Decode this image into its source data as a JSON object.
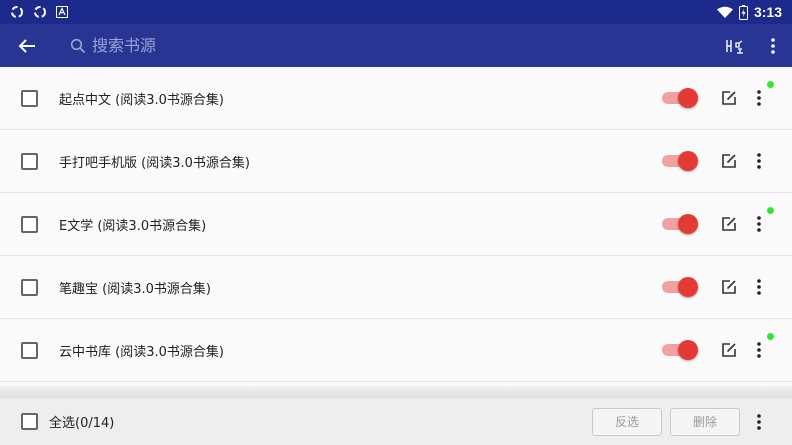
{
  "status_bar": {
    "time": "3:13"
  },
  "toolbar": {
    "search_placeholder": "搜索书源"
  },
  "sources": [
    {
      "name": "起点中文 (阅读3.0书源合集)",
      "enabled": true,
      "dot": true
    },
    {
      "name": "手打吧手机版 (阅读3.0书源合集)",
      "enabled": true,
      "dot": false
    },
    {
      "name": "E文学 (阅读3.0书源合集)",
      "enabled": true,
      "dot": true
    },
    {
      "name": "笔趣宝 (阅读3.0书源合集)",
      "enabled": true,
      "dot": false
    },
    {
      "name": "云中书库 (阅读3.0书源合集)",
      "enabled": true,
      "dot": true
    }
  ],
  "bottom_bar": {
    "select_all_label": "全选(0/14)",
    "invert_label": "反选",
    "delete_label": "删除"
  },
  "colors": {
    "status_bar": "#1c2a8c",
    "toolbar": "#283593",
    "switch_thumb": "#e53935",
    "switch_track": "#f1a1a1",
    "active_dot": "#2ee82e"
  },
  "icons": {
    "back": "arrow-left-icon",
    "search": "search-icon",
    "sort": "sort-icon",
    "more": "more-vert-icon",
    "edit": "edit-icon"
  }
}
